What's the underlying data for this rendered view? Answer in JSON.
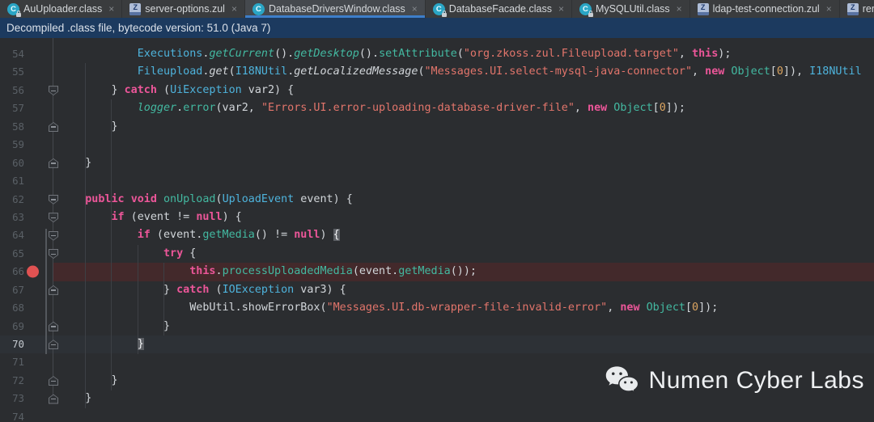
{
  "tabs": [
    {
      "label": "AuUploader.class",
      "icon": "class-locked-icon",
      "active": false,
      "closable": true
    },
    {
      "label": "server-options.zul",
      "icon": "zul-file-icon",
      "active": false,
      "closable": true
    },
    {
      "label": "DatabaseDriversWindow.class",
      "icon": "class-icon",
      "active": true,
      "closable": true
    },
    {
      "label": "DatabaseFacade.class",
      "icon": "class-locked-icon",
      "active": false,
      "closable": true
    },
    {
      "label": "MySQLUtil.class",
      "icon": "class-locked-icon",
      "active": false,
      "closable": true
    },
    {
      "label": "ldap-test-connection.zul",
      "icon": "zul-file-icon",
      "active": false,
      "closable": true
    },
    {
      "label": "remote-replica.zul",
      "icon": "zul-file-icon",
      "active": false,
      "closable": false
    }
  ],
  "banner": {
    "text": "Decompiled .class file, bytecode version: 51.0 (Java 7)"
  },
  "editor": {
    "first_line": 54,
    "breakpoint_line": 66,
    "caret_line": 70,
    "colors": {
      "background": "#2b2d30",
      "keyword": "#ec5699",
      "string": "#e2756b",
      "class_name": "#4eb3dc",
      "method": "#43b9a1",
      "number": "#dca561",
      "breakpoint_row": "#43292b",
      "breakpoint_dot": "#e05252",
      "caret_row": "#2d3136",
      "banner_bg": "#1c3a5f",
      "tab_underline": "#3d7ec9"
    },
    "lines": [
      {
        "n": 54,
        "fold": null,
        "segs": [
          [
            "            ",
            "d"
          ],
          [
            "Executions",
            "cl"
          ],
          [
            ".",
            "d"
          ],
          [
            "getCurrent",
            "mi"
          ],
          [
            "().",
            "d"
          ],
          [
            "getDesktop",
            "mi"
          ],
          [
            "().",
            "d"
          ],
          [
            "setAttribute",
            "m"
          ],
          [
            "(",
            "d"
          ],
          [
            "\"org.zkoss.zul.Fileupload.target\"",
            "s"
          ],
          [
            ", ",
            "d"
          ],
          [
            "this",
            "k"
          ],
          [
            ");",
            "d"
          ]
        ]
      },
      {
        "n": 55,
        "fold": null,
        "segs": [
          [
            "            ",
            "d"
          ],
          [
            "Fileupload",
            "cl"
          ],
          [
            ".",
            "d"
          ],
          [
            "get",
            "wi"
          ],
          [
            "(",
            "d"
          ],
          [
            "I18NUtil",
            "cl"
          ],
          [
            ".",
            "d"
          ],
          [
            "getLocalizedMessage",
            "wi"
          ],
          [
            "(",
            "d"
          ],
          [
            "\"Messages.UI.select-mysql-java-connector\"",
            "s"
          ],
          [
            ", ",
            "d"
          ],
          [
            "new",
            "k"
          ],
          [
            " ",
            "d"
          ],
          [
            "Object",
            "m"
          ],
          [
            "[",
            "d"
          ],
          [
            "0",
            "n"
          ],
          [
            "]), ",
            "d"
          ],
          [
            "I18NUtil",
            "cl"
          ]
        ]
      },
      {
        "n": 56,
        "fold": "down",
        "segs": [
          [
            "        ",
            "d"
          ],
          [
            "} ",
            "d"
          ],
          [
            "catch",
            "k"
          ],
          [
            " (",
            "d"
          ],
          [
            "UiException",
            "cl"
          ],
          [
            " var2) {",
            "d"
          ]
        ]
      },
      {
        "n": 57,
        "fold": null,
        "segs": [
          [
            "            ",
            "d"
          ],
          [
            "logger",
            "mi"
          ],
          [
            ".",
            "d"
          ],
          [
            "error",
            "m"
          ],
          [
            "(var2, ",
            "d"
          ],
          [
            "\"Errors.UI.error-uploading-database-driver-file\"",
            "s"
          ],
          [
            ", ",
            "d"
          ],
          [
            "new",
            "k"
          ],
          [
            " ",
            "d"
          ],
          [
            "Object",
            "m"
          ],
          [
            "[",
            "d"
          ],
          [
            "0",
            "n"
          ],
          [
            "]);",
            "d"
          ]
        ]
      },
      {
        "n": 58,
        "fold": "up",
        "segs": [
          [
            "        ",
            "d"
          ],
          [
            "}",
            "d"
          ]
        ]
      },
      {
        "n": 59,
        "fold": null,
        "segs": []
      },
      {
        "n": 60,
        "fold": "up",
        "segs": [
          [
            "    ",
            "d"
          ],
          [
            "}",
            "d"
          ]
        ]
      },
      {
        "n": 61,
        "fold": null,
        "segs": []
      },
      {
        "n": 62,
        "fold": "down",
        "segs": [
          [
            "    ",
            "d"
          ],
          [
            "public",
            "k"
          ],
          [
            " ",
            "d"
          ],
          [
            "void",
            "k"
          ],
          [
            " ",
            "d"
          ],
          [
            "onUpload",
            "m"
          ],
          [
            "(",
            "d"
          ],
          [
            "UploadEvent",
            "cl"
          ],
          [
            " event) {",
            "d"
          ]
        ]
      },
      {
        "n": 63,
        "fold": "down",
        "segs": [
          [
            "        ",
            "d"
          ],
          [
            "if",
            "k"
          ],
          [
            " (event != ",
            "d"
          ],
          [
            "null",
            "k"
          ],
          [
            ") {",
            "d"
          ]
        ]
      },
      {
        "n": 64,
        "fold": "down",
        "segs": [
          [
            "            ",
            "d"
          ],
          [
            "if",
            "k"
          ],
          [
            " (event.",
            "d"
          ],
          [
            "getMedia",
            "m"
          ],
          [
            "() != ",
            "d"
          ],
          [
            "null",
            "k"
          ],
          [
            ") ",
            "d"
          ],
          [
            "{",
            "bb"
          ]
        ]
      },
      {
        "n": 65,
        "fold": "down",
        "segs": [
          [
            "                ",
            "d"
          ],
          [
            "try",
            "k"
          ],
          [
            " {",
            "d"
          ]
        ]
      },
      {
        "n": 66,
        "fold": null,
        "segs": [
          [
            "                    ",
            "d"
          ],
          [
            "this",
            "k"
          ],
          [
            ".",
            "d"
          ],
          [
            "processUploadedMedia",
            "m"
          ],
          [
            "(event.",
            "d"
          ],
          [
            "getMedia",
            "m"
          ],
          [
            "());",
            "d"
          ]
        ]
      },
      {
        "n": 67,
        "fold": "up",
        "segs": [
          [
            "                ",
            "d"
          ],
          [
            "} ",
            "d"
          ],
          [
            "catch",
            "k"
          ],
          [
            " (",
            "d"
          ],
          [
            "IOException",
            "cl"
          ],
          [
            " var3) {",
            "d"
          ]
        ]
      },
      {
        "n": 68,
        "fold": null,
        "segs": [
          [
            "                    ",
            "d"
          ],
          [
            "WebUtil.showErrorBox(",
            "d"
          ],
          [
            "\"Messages.UI.db-wrapper-file-invalid-error\"",
            "s"
          ],
          [
            ", ",
            "d"
          ],
          [
            "new",
            "k"
          ],
          [
            " ",
            "d"
          ],
          [
            "Object",
            "m"
          ],
          [
            "[",
            "d"
          ],
          [
            "0",
            "n"
          ],
          [
            "]);",
            "d"
          ]
        ]
      },
      {
        "n": 69,
        "fold": "up",
        "segs": [
          [
            "                ",
            "d"
          ],
          [
            "}",
            "d"
          ]
        ]
      },
      {
        "n": 70,
        "fold": "up",
        "segs": [
          [
            "            ",
            "d"
          ],
          [
            "}",
            "bb"
          ]
        ]
      },
      {
        "n": 71,
        "fold": null,
        "segs": []
      },
      {
        "n": 72,
        "fold": "up",
        "segs": [
          [
            "        ",
            "d"
          ],
          [
            "}",
            "d"
          ]
        ]
      },
      {
        "n": 73,
        "fold": "up",
        "segs": [
          [
            "    ",
            "d"
          ],
          [
            "}",
            "d"
          ]
        ]
      },
      {
        "n": 74,
        "fold": null,
        "segs": []
      }
    ]
  },
  "watermark": {
    "text": "Numen Cyber Labs",
    "icon": "wechat-icon"
  }
}
